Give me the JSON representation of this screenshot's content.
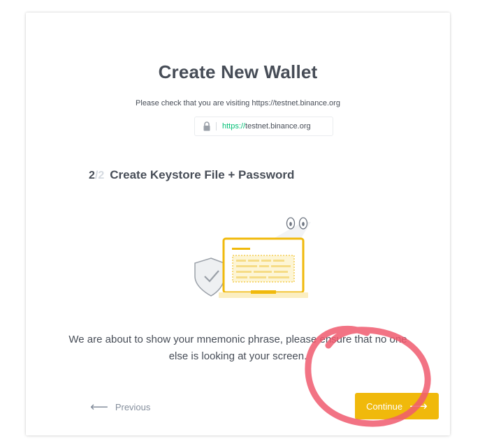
{
  "page": {
    "title": "Create New Wallet",
    "notice": "Please check that you are visiting https://testnet.binance.org"
  },
  "url_bar": {
    "scheme": "https://",
    "host": "testnet.binance.org",
    "icon": "lock-icon"
  },
  "step": {
    "current": "2",
    "total": "/2",
    "title": "Create Keystore File + Password"
  },
  "message": "We are about to show your mnemonic phrase, please ensure that no one else is looking at your screen.",
  "buttons": {
    "previous_label": "Previous",
    "continue_label": "Continue"
  },
  "colors": {
    "accent": "#f0b90b",
    "secure_green": "#02c076",
    "annotation": "#f05a6e"
  }
}
